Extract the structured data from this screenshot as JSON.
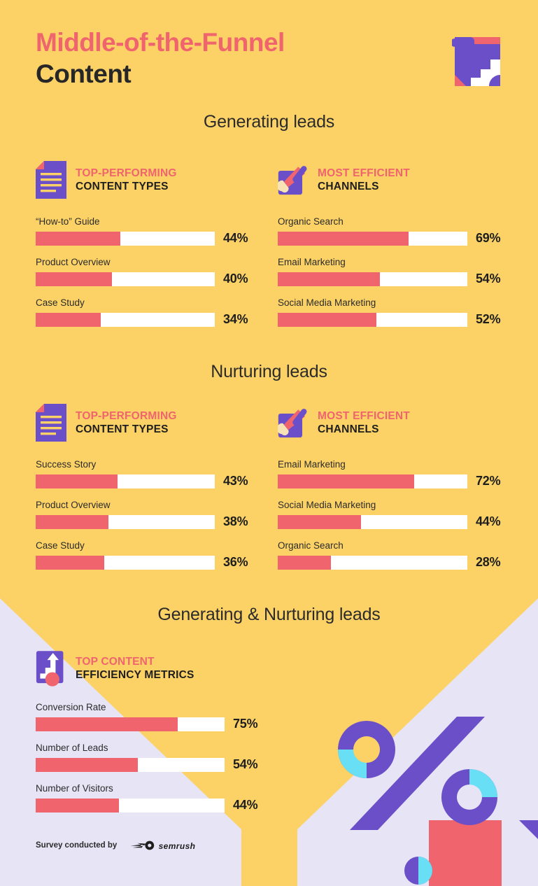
{
  "header": {
    "title_line1": "Middle-of-the-Funnel",
    "title_line2": "Content",
    "logo_name": "semrush-folder-logo"
  },
  "colors": {
    "background_yellow": "#FCD266",
    "background_lavender": "#E6E4F5",
    "accent_red": "#F0646E",
    "accent_purple": "#6B4FC8",
    "accent_cyan": "#69DFF5",
    "text_dark": "#1E1E1E",
    "bar_track": "#FFFFFF"
  },
  "sections": [
    {
      "heading": "Generating leads",
      "blocks": [
        {
          "icon": "document-icon",
          "kicker": "TOP-PERFORMING",
          "subtitle": "CONTENT TYPES",
          "bars": [
            {
              "label": "“How-to” Guide",
              "value": 44,
              "display": "44%"
            },
            {
              "label": "Product Overview",
              "value": 40,
              "display": "40%"
            },
            {
              "label": "Case Study",
              "value": 34,
              "display": "34%"
            }
          ]
        },
        {
          "icon": "megaphone-icon",
          "kicker": "MOST EFFICIENT",
          "subtitle": "CHANNELS",
          "bars": [
            {
              "label": "Organic Search",
              "value": 69,
              "display": "69%"
            },
            {
              "label": "Email Marketing",
              "value": 54,
              "display": "54%"
            },
            {
              "label": "Social Media Marketing",
              "value": 52,
              "display": "52%"
            }
          ]
        }
      ]
    },
    {
      "heading": "Nurturing leads",
      "blocks": [
        {
          "icon": "document-icon",
          "kicker": "TOP-PERFORMING",
          "subtitle": "CONTENT TYPES",
          "bars": [
            {
              "label": "Success Story",
              "value": 43,
              "display": "43%"
            },
            {
              "label": "Product Overview",
              "value": 38,
              "display": "38%"
            },
            {
              "label": "Case Study",
              "value": 36,
              "display": "36%"
            }
          ]
        },
        {
          "icon": "megaphone-icon",
          "kicker": "MOST EFFICIENT",
          "subtitle": "CHANNELS",
          "bars": [
            {
              "label": "Email Marketing",
              "value": 72,
              "display": "72%"
            },
            {
              "label": "Social Media Marketing",
              "value": 44,
              "display": "44%"
            },
            {
              "label": "Organic Search",
              "value": 28,
              "display": "28%"
            }
          ]
        }
      ]
    },
    {
      "heading": "Generating & Nurturing leads",
      "blocks": [
        {
          "icon": "growth-chart-icon",
          "kicker": "TOP CONTENT",
          "subtitle": "EFFICIENCY METRICS",
          "bars": [
            {
              "label": "Conversion Rate",
              "value": 75,
              "display": "75%"
            },
            {
              "label": "Number of Leads",
              "value": 54,
              "display": "54%"
            },
            {
              "label": "Number of Visitors",
              "value": 44,
              "display": "44%"
            }
          ]
        }
      ]
    }
  ],
  "footer": {
    "credit_text": "Survey conducted by",
    "brand": "semrush",
    "brand_logo_name": "semrush-comet-logo"
  },
  "chart_data": {
    "type": "bar",
    "title": "Middle-of-the-Funnel Content",
    "xlabel": "",
    "ylabel": "",
    "xlim": [
      0,
      100
    ],
    "grid": false,
    "legend": "none",
    "groups": [
      {
        "section": "Generating leads",
        "panel": "TOP-PERFORMING CONTENT TYPES",
        "categories": [
          "“How-to” Guide",
          "Product Overview",
          "Case Study"
        ],
        "values": [
          44,
          40,
          34
        ]
      },
      {
        "section": "Generating leads",
        "panel": "MOST EFFICIENT CHANNELS",
        "categories": [
          "Organic Search",
          "Email Marketing",
          "Social Media Marketing"
        ],
        "values": [
          69,
          54,
          52
        ]
      },
      {
        "section": "Nurturing leads",
        "panel": "TOP-PERFORMING CONTENT TYPES",
        "categories": [
          "Success Story",
          "Product Overview",
          "Case Study"
        ],
        "values": [
          43,
          38,
          36
        ]
      },
      {
        "section": "Nurturing leads",
        "panel": "MOST EFFICIENT CHANNELS",
        "categories": [
          "Email Marketing",
          "Social Media Marketing",
          "Organic Search"
        ],
        "values": [
          72,
          44,
          28
        ]
      },
      {
        "section": "Generating & Nurturing leads",
        "panel": "TOP CONTENT EFFICIENCY METRICS",
        "categories": [
          "Conversion Rate",
          "Number of Leads",
          "Number of Visitors"
        ],
        "values": [
          75,
          54,
          44
        ]
      }
    ]
  }
}
